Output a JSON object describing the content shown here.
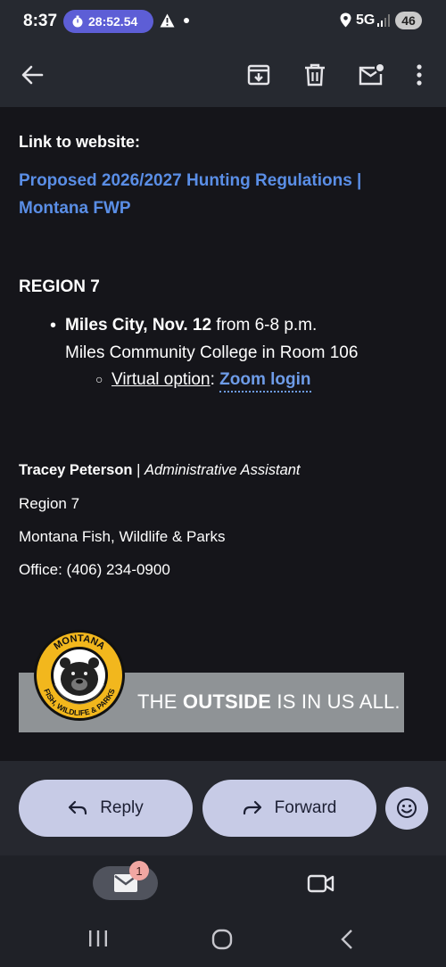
{
  "status_bar": {
    "time": "8:37",
    "timer": "28:52.54",
    "network": "5G",
    "battery": "46"
  },
  "toolbar": {
    "icons": [
      "back-arrow-icon",
      "archive-icon",
      "delete-icon",
      "mark-unread-icon",
      "more-vert-icon"
    ]
  },
  "email": {
    "link_heading": "Link to website:",
    "link_line1": "Proposed 2026/2027 Hunting Regulations |",
    "link_line2": "Montana FWP",
    "region_heading": "REGION 7",
    "bullet_city": "Miles City, Nov. 12",
    "bullet_time": " from 6-8 p.m.",
    "bullet_location": "Miles Community College in Room 106",
    "virtual_label": "Virtual option",
    "virtual_sep": ": ",
    "zoom_link": "Zoom login",
    "sig_name": "Tracey Peterson",
    "sig_sep": " | ",
    "sig_title": "Administrative Assistant",
    "sig_region": "Region 7",
    "sig_org": "Montana Fish, Wildlife & Parks",
    "sig_office": "Office: (406) 234-0900"
  },
  "banner": {
    "text_pre": "THE ",
    "text_bold": "OUTSIDE",
    "text_post": " IS IN US ALL.",
    "logo_top": "MONTANA",
    "logo_bottom": "FISH, WILDLIFE & PARKS"
  },
  "actions": {
    "reply": "Reply",
    "forward": "Forward"
  },
  "bottom_nav": {
    "mail_badge": "1"
  },
  "colors": {
    "link": "#5a8ee6",
    "pill": "#c7cbe6",
    "timer": "#5d5ed6"
  }
}
